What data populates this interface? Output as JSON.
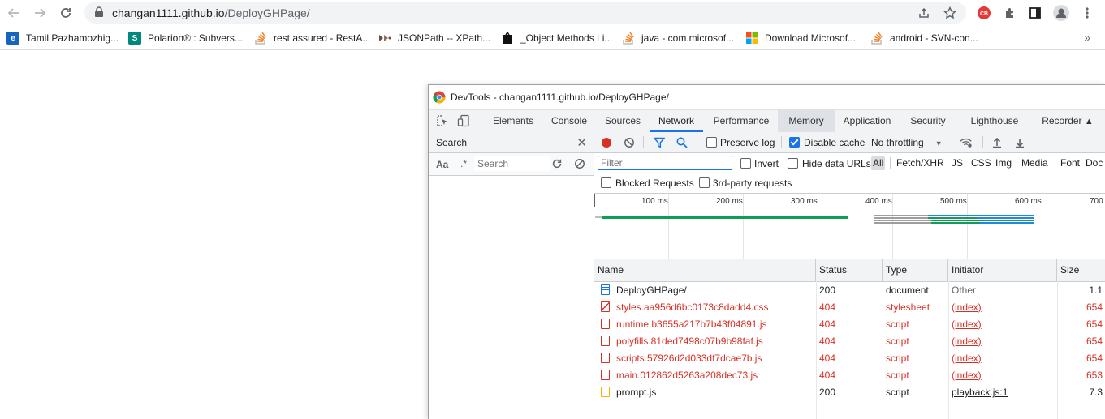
{
  "browser": {
    "url_host": "changan1111.github.io",
    "url_path": "/DeployGHPage/"
  },
  "bookmarks": [
    {
      "label": "Tamil Pazhamozhig...",
      "icon": "e-logo-icon",
      "color": "#1565c0"
    },
    {
      "label": "Polarion® : Subvers...",
      "icon": "s-logo-icon",
      "color": "#00897b"
    },
    {
      "label": "rest assured - RestA...",
      "icon": "stackoverflow-icon",
      "color": "#f48024"
    },
    {
      "label": "JSONPath -- XPath...",
      "icon": "jsonpath-icon",
      "color": "#6d4c41"
    },
    {
      "label": "_Object Methods Li...",
      "icon": "black-tag-icon",
      "color": "#111111"
    },
    {
      "label": "java - com.microsof...",
      "icon": "stackoverflow-icon",
      "color": "#f48024"
    },
    {
      "label": "Download Microsof...",
      "icon": "microsoft-icon",
      "color": "#f25022"
    },
    {
      "label": "android - SVN-con...",
      "icon": "stackoverflow-icon",
      "color": "#f48024"
    }
  ],
  "devtools": {
    "title": "DevTools - changan1111.github.io/DeployGHPage/",
    "tabs": [
      "Elements",
      "Console",
      "Sources",
      "Network",
      "Performance",
      "Memory",
      "Application",
      "Security",
      "Lighthouse",
      "Recorder"
    ],
    "active_tab": "Network",
    "search_pane": {
      "title": "Search",
      "case_label": "Aa",
      "regex_label": ".*",
      "placeholder": "Search"
    },
    "network": {
      "preserve_log": "Preserve log",
      "disable_cache": "Disable cache",
      "throttling": "No throttling",
      "filter_placeholder": "Filter",
      "invert": "Invert",
      "hide_data_urls": "Hide data URLs",
      "types": [
        "All",
        "Fetch/XHR",
        "JS",
        "CSS",
        "Img",
        "Media",
        "Font",
        "Doc"
      ],
      "active_type": "All",
      "blocked_requests": "Blocked Requests",
      "third_party": "3rd-party requests",
      "ticks": [
        "100 ms",
        "200 ms",
        "300 ms",
        "400 ms",
        "500 ms",
        "600 ms",
        "700"
      ],
      "columns": [
        "Name",
        "Status",
        "Type",
        "Initiator",
        "Size"
      ],
      "rows": [
        {
          "name": "DeployGHPage/",
          "status": "200",
          "type": "document",
          "initiator": "Other",
          "size": "1.1",
          "error": false,
          "icon": "document-icon",
          "link": false
        },
        {
          "name": "styles.aa956d6bc0173c8dadd4.css",
          "status": "404",
          "type": "stylesheet",
          "initiator": "(index)",
          "size": "654",
          "error": true,
          "icon": "stylesheet-icon",
          "link": true
        },
        {
          "name": "runtime.b3655a217b7b43f04891.js",
          "status": "404",
          "type": "script",
          "initiator": "(index)",
          "size": "654",
          "error": true,
          "icon": "script-icon",
          "link": true
        },
        {
          "name": "polyfills.81ded7498c07b9b98faf.js",
          "status": "404",
          "type": "script",
          "initiator": "(index)",
          "size": "654",
          "error": true,
          "icon": "script-icon",
          "link": true
        },
        {
          "name": "scripts.57926d2d033df7dcae7b.js",
          "status": "404",
          "type": "script",
          "initiator": "(index)",
          "size": "654",
          "error": true,
          "icon": "script-icon",
          "link": true
        },
        {
          "name": "main.012862d5263a208dec73.js",
          "status": "404",
          "type": "script",
          "initiator": "(index)",
          "size": "653",
          "error": true,
          "icon": "script-icon",
          "link": true
        },
        {
          "name": "prompt.js",
          "status": "200",
          "type": "script",
          "initiator": "playback.js:1",
          "size": "7.3",
          "error": false,
          "icon": "script-icon",
          "link": true
        }
      ]
    }
  },
  "colors": {
    "accent": "#1a73e8",
    "error": "#d93025",
    "record": "#d93025"
  }
}
